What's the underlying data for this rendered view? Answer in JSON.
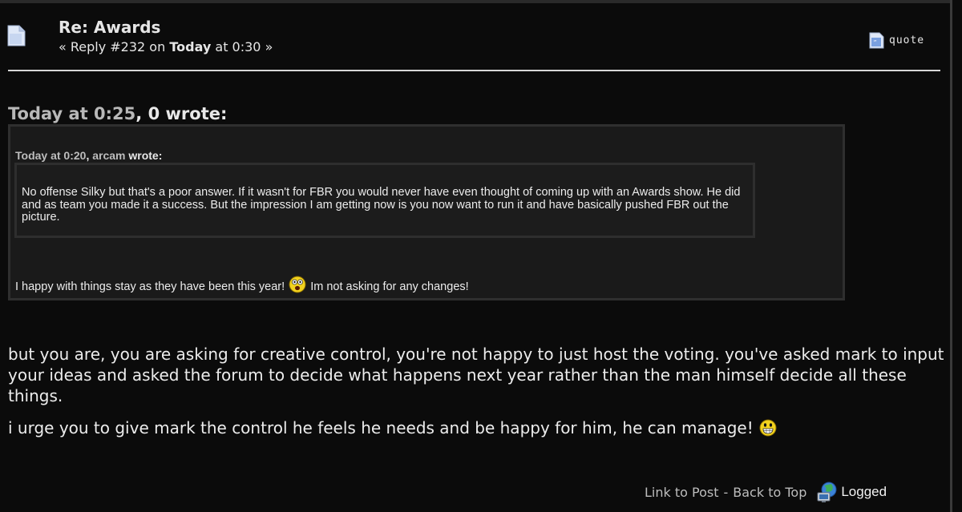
{
  "post": {
    "subject": "Re: Awards",
    "reply_prefix": "« Reply #232 on",
    "reply_date": "Today",
    "reply_time": "at 0:30 »",
    "quote_label": "quote"
  },
  "outer_quote": {
    "date": "Today at 0:25",
    "separator": ",",
    "author": "0",
    "wrote": "wrote:",
    "text_before": "I happy with things stay as they have been this year!",
    "text_after": "Im not asking for any changes!"
  },
  "inner_quote": {
    "date": "Today at 0:20",
    "separator": ",",
    "author": "arcam",
    "wrote": "wrote:",
    "text": "No offense Silky but that's a poor answer. If it wasn't for FBR you would never have even thought of coming up with an Awards show. He did and as team you made it a success. But the impression I am getting now is you now want to run it and have basically pushed FBR out the picture."
  },
  "body": {
    "paragraph1": "but you are, you are asking for creative control, you're not happy to just host the voting. you've asked mark to input your ideas and asked the forum to decide what happens next year rather than the man himself decide all these things.",
    "paragraph2": "i urge you to give mark the control he feels he needs and be happy for him, he can manage!"
  },
  "footer": {
    "link_to_post": "Link to Post",
    "dash": "-",
    "back_to_top": "Back to Top",
    "logged": "Logged"
  },
  "icons": {
    "post": "document-icon",
    "quote": "quote-icon",
    "shocked_smiley": "shocked-smiley-icon",
    "grin_smiley": "grin-smiley-icon",
    "logged": "globe-computer-icon"
  }
}
